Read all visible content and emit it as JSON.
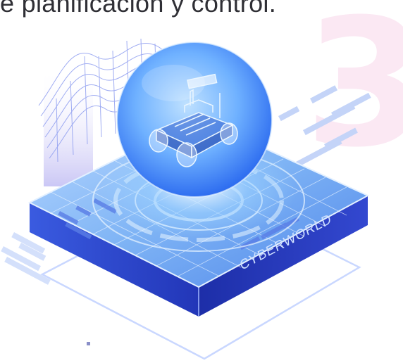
{
  "headline": "e planificación y control.",
  "section_number": "3",
  "platform_label": "CYBERWORLD",
  "colors": {
    "accent_pink": "#fbe8f3",
    "platform_side": "#2a3fc8",
    "platform_top": "#7fb4f5",
    "sphere_glow": "#5fa8ff",
    "wireframe": "#8f9ef0"
  },
  "icons": [
    "robot-car-icon",
    "sphere-icon",
    "platform-icon",
    "wireframe-surface-icon"
  ]
}
